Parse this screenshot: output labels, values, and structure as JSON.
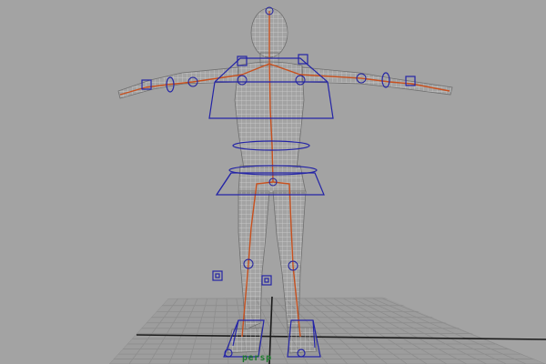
{
  "viewport": {
    "camera_label": "persp",
    "colors": {
      "background": "#a3a3a3",
      "grid": "#8d8d8d",
      "grid_axis": "#202020",
      "mesh_wire": "#d2d2d2",
      "mesh_shadow": "#7a7a7a",
      "bones": "#c8501e",
      "controls": "#2020a0",
      "camera_label": "#1f7a2f"
    },
    "scene": {
      "grid": "ground-grid",
      "character": "wireframe-character-mesh",
      "skeleton": "joint-chain",
      "controls": [
        "chest-control",
        "hip-control",
        "waist-ring",
        "foot-control-left",
        "foot-control-right",
        "knee-pole-left",
        "knee-pole-right"
      ]
    }
  }
}
